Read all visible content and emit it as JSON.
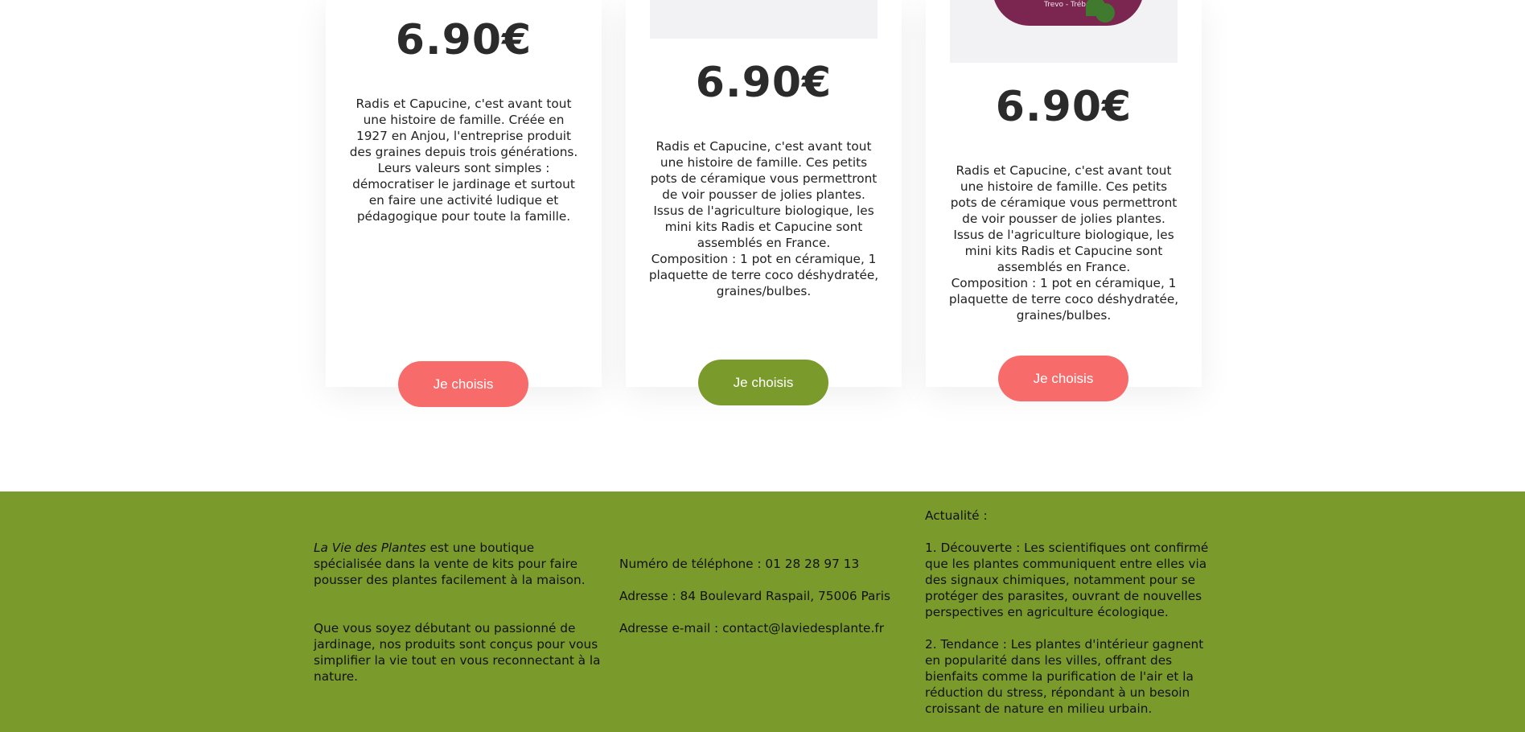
{
  "cards": [
    {
      "price": "6.90€",
      "description": "Radis et Capucine, c'est avant tout une histoire de famille. Créée en 1927 en Anjou, l'entreprise produit des graines depuis trois générations.\nLeurs valeurs sont simples : démocratiser le jardinage et surtout en faire une activité ludique et pédagogique pour toute la famille.",
      "button_label": "Je choisis",
      "button_color": "#f76c6a"
    },
    {
      "price": "6.90€",
      "description": "Radis et Capucine, c'est avant tout une histoire de famille. Ces petits pots de céramique vous permettront de voir pousser de jolies plantes.\nIssus de l'agriculture biologique, les mini kits Radis et Capucine sont assemblés en France.\nComposition : 1 pot en céramique, 1 plaquette de terre coco déshydratée, graines/bulbes.",
      "button_label": "Je choisis",
      "button_color": "#7a9b2c"
    },
    {
      "price": "6.90€",
      "pot_label": "Kleeblatt - Quadrifoglio\nTrevo - Trébol",
      "description": "Radis et Capucine, c'est avant tout une histoire de famille. Ces petits pots de céramique vous permettront de voir pousser de jolies plantes.\nIssus de l'agriculture biologique, les mini kits Radis et Capucine sont assemblés en France.\nComposition : 1 pot en céramique, 1 plaquette de terre coco déshydratée, graines/bulbes.",
      "button_label": "Je choisis",
      "button_color": "#f76c6a"
    }
  ],
  "footer": {
    "background_color": "#7a9b2c",
    "about": {
      "brand": "La Vie des Plantes",
      "intro_rest": " est une boutique spécialisée dans la vente de kits pour faire pousser des plantes facilement à la maison.",
      "second": "Que vous soyez débutant ou passionné de jardinage, nos produits sont conçus pour vous simplifier la vie tout en vous reconnectant à la nature."
    },
    "contact": {
      "phone": "Numéro de téléphone : 01 28 28 97 13",
      "address": "Adresse : 84 Boulevard Raspail, 75006 Paris",
      "email": "Adresse e-mail : contact@laviedesplante.fr"
    },
    "news": {
      "heading": "Actualité :",
      "items": [
        "1. Découverte : Les scientifiques ont confirmé que les plantes communiquent entre elles via des signaux chimiques, notamment pour se protéger des parasites, ouvrant de nouvelles perspectives en agriculture écologique.",
        "2. Tendance : Les plantes d'intérieur gagnent en popularité dans les villes, offrant des bienfaits comme la purification de l'air et la réduction du stress, répondant à un besoin croissant de nature en milieu urbain."
      ]
    }
  }
}
